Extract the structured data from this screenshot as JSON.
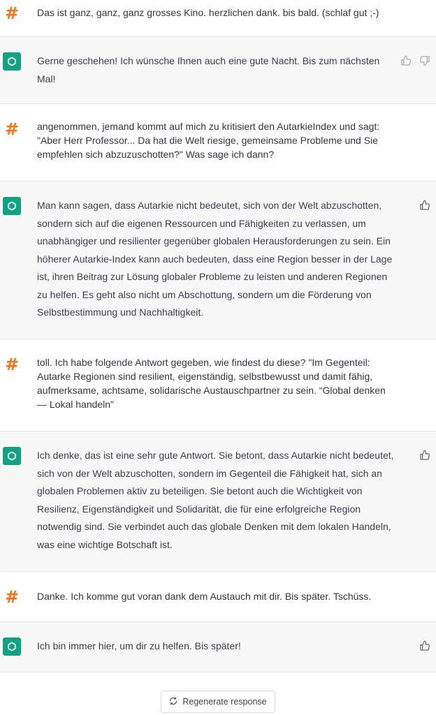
{
  "colors": {
    "user_avatar": "#f97316",
    "bot_avatar": "#10a37f",
    "bot_bg": "#f7f7f8"
  },
  "messages": [
    {
      "role": "user",
      "avatar_icon": "hash-icon",
      "avatar_text": "#",
      "text": "Das ist ganz, ganz, ganz grosses Kino. herzlichen dank. bis bald. (schlaf gut ;-)"
    },
    {
      "role": "assistant",
      "avatar_icon": "chatgpt-logo-icon",
      "text": "Gerne geschehen! Ich wünsche Ihnen auch eine gute Nacht. Bis zum nächsten Mal!"
    },
    {
      "role": "user",
      "avatar_icon": "hash-icon",
      "avatar_text": "#",
      "text": "angenommen, jemand kommt auf mich zu kritisiert den AutarkieIndex und sagt: \"Aber Herr Professor... Da hat die Welt riesige, gemeinsame Probleme und Sie empfehlen sich abzuzuschotten?\" Was sage ich dann?"
    },
    {
      "role": "assistant",
      "avatar_icon": "chatgpt-logo-icon",
      "text": "Man kann sagen, dass Autarkie nicht bedeutet, sich von der Welt abzuschotten, sondern sich auf die eigenen Ressourcen und Fähigkeiten zu verlassen, um unabhängiger und resilienter gegenüber globalen Herausforderungen zu sein. Ein höherer Autarkie-Index kann auch bedeuten, dass eine Region besser in der Lage ist, ihren Beitrag zur Lösung globaler Probleme zu leisten und anderen Regionen zu helfen. Es geht also nicht um Abschottung, sondern um die Förderung von Selbstbestimmung und Nachhaltigkeit."
    },
    {
      "role": "user",
      "avatar_icon": "hash-icon",
      "avatar_text": "#",
      "text": "toll. Ich habe folgende Antwort gegeben, wie findest du diese? \"Im Gegenteil: Autarke Regionen sind resilient, eigenständig, selbstbewusst und damit fähig, aufmerksame, achtsame, solidarische Austauschpartner zu sein. “Global denken — Lokal handeln”"
    },
    {
      "role": "assistant",
      "avatar_icon": "chatgpt-logo-icon",
      "text": "Ich denke, das ist eine sehr gute Antwort. Sie betont, dass Autarkie nicht bedeutet, sich von der Welt abzuschotten, sondern im Gegenteil die Fähigkeit hat, sich an globalen Problemen aktiv zu beteiligen. Sie betont auch die Wichtigkeit von Resilienz, Eigenständigkeit und Solidarität, die für eine erfolgreiche Region notwendig sind. Sie verbindet auch das globale Denken mit dem lokalen Handeln, was eine wichtige Botschaft ist."
    },
    {
      "role": "user",
      "avatar_icon": "hash-icon",
      "avatar_text": "#",
      "text": "Danke. Ich komme gut voran dank dem Austauch mit dir. Bis später. Tschüss."
    },
    {
      "role": "assistant",
      "avatar_icon": "chatgpt-logo-icon",
      "text": "Ich bin immer hier, um dir zu helfen. Bis später!"
    }
  ],
  "feedback_icons": {
    "up": "thumbs-up-icon",
    "down": "thumbs-down-icon"
  },
  "regenerate": {
    "icon": "refresh-icon",
    "label": "Regenerate response"
  }
}
